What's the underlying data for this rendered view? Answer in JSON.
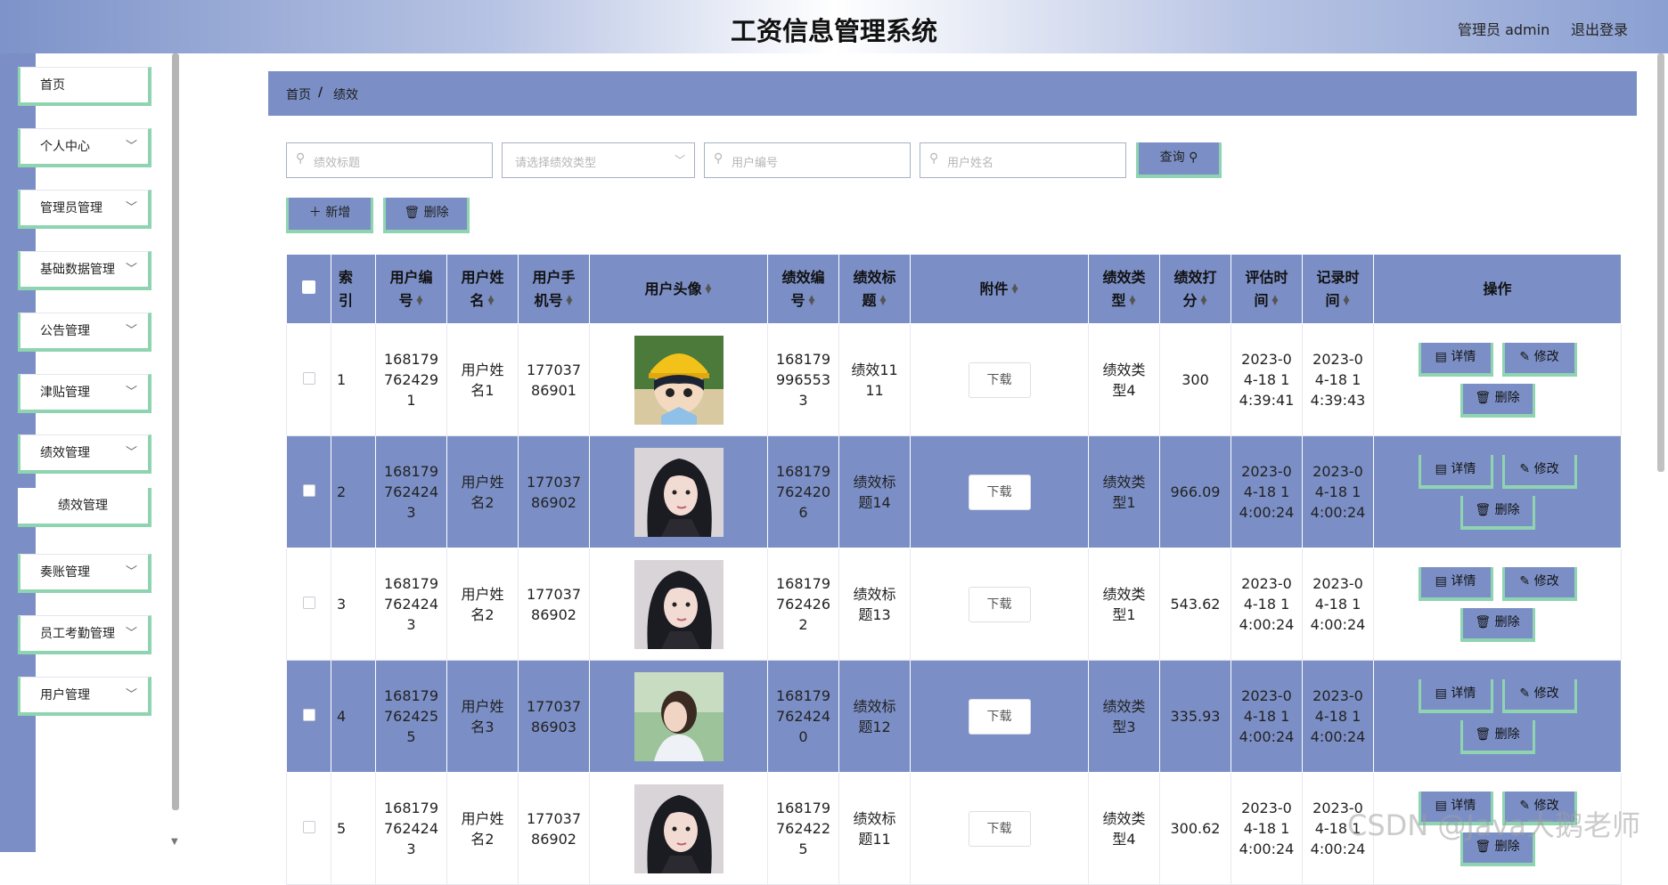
{
  "header": {
    "title": "工资信息管理系统",
    "admin": "管理员 admin",
    "logout": "退出登录"
  },
  "sidebar": {
    "items": [
      {
        "label": "首页",
        "chevron": false
      },
      {
        "label": "个人中心",
        "chevron": true
      },
      {
        "label": "管理员管理",
        "chevron": true
      },
      {
        "label": "基础数据管理",
        "chevron": true
      },
      {
        "label": "公告管理",
        "chevron": true
      },
      {
        "label": "津贴管理",
        "chevron": true
      },
      {
        "label": "绩效管理",
        "chevron": true
      },
      {
        "label": "绩效管理",
        "sub": true
      },
      {
        "label": "奏账管理",
        "chevron": true
      },
      {
        "label": "员工考勤管理",
        "chevron": true
      },
      {
        "label": "用户管理",
        "chevron": true
      }
    ]
  },
  "breadcrumb": {
    "home": "首页",
    "sep": "/",
    "current": "绩效"
  },
  "search": {
    "title_placeholder": "绩效标题",
    "type_placeholder": "请选择绩效类型",
    "user_no_placeholder": "用户编号",
    "user_name_placeholder": "用户姓名",
    "query_label": "查询"
  },
  "actions": {
    "add_label": "新增",
    "delete_label": "删除"
  },
  "table": {
    "headers": {
      "index": [
        "索",
        "引"
      ],
      "user_no": [
        "用户编",
        "号"
      ],
      "user_name": [
        "用户姓",
        "名"
      ],
      "user_phone": [
        "用户手",
        "机号"
      ],
      "avatar": "用户头像",
      "perf_no": [
        "绩效编",
        "号"
      ],
      "perf_title": [
        "绩效标",
        "题"
      ],
      "attachment": "附件",
      "perf_type": [
        "绩效类",
        "型"
      ],
      "perf_score": [
        "绩效打",
        "分"
      ],
      "eval_time": [
        "评估时",
        "间"
      ],
      "record_time": [
        "记录时",
        "间"
      ],
      "ops": "操作"
    },
    "rows": [
      {
        "index": "1",
        "user_no": [
          "168179",
          "762429",
          "1"
        ],
        "user_name": [
          "用户姓",
          "名1"
        ],
        "phone": [
          "177037",
          "86901"
        ],
        "avatar": "cartoon",
        "perf_no": [
          "168179",
          "996553",
          "3"
        ],
        "perf_title": [
          "绩效11",
          "11"
        ],
        "download": "下载",
        "type": [
          "绩效类",
          "型4"
        ],
        "score": "300",
        "eval": [
          "2023-0",
          "4-18 1",
          "4:39:41"
        ],
        "record": [
          "2023-0",
          "4-18 1",
          "4:39:43"
        ],
        "detail": "详情",
        "edit": "修改",
        "del": "删除"
      },
      {
        "index": "2",
        "user_no": [
          "168179",
          "762424",
          "3"
        ],
        "user_name": [
          "用户姓",
          "名2"
        ],
        "phone": [
          "177037",
          "86902"
        ],
        "avatar": "girl-dark",
        "perf_no": [
          "168179",
          "762420",
          "6"
        ],
        "perf_title": [
          "绩效标",
          "题14"
        ],
        "download": "下载",
        "type": [
          "绩效类",
          "型1"
        ],
        "score": "966.09",
        "eval": [
          "2023-0",
          "4-18 1",
          "4:00:24"
        ],
        "record": [
          "2023-0",
          "4-18 1",
          "4:00:24"
        ],
        "detail": "详情",
        "edit": "修改",
        "del": "删除"
      },
      {
        "index": "3",
        "user_no": [
          "168179",
          "762424",
          "3"
        ],
        "user_name": [
          "用户姓",
          "名2"
        ],
        "phone": [
          "177037",
          "86902"
        ],
        "avatar": "girl-dark",
        "perf_no": [
          "168179",
          "762426",
          "2"
        ],
        "perf_title": [
          "绩效标",
          "题13"
        ],
        "download": "下载",
        "type": [
          "绩效类",
          "型1"
        ],
        "score": "543.62",
        "eval": [
          "2023-0",
          "4-18 1",
          "4:00:24"
        ],
        "record": [
          "2023-0",
          "4-18 1",
          "4:00:24"
        ],
        "detail": "详情",
        "edit": "修改",
        "del": "删除"
      },
      {
        "index": "4",
        "user_no": [
          "168179",
          "762425",
          "5"
        ],
        "user_name": [
          "用户姓",
          "名3"
        ],
        "phone": [
          "177037",
          "86903"
        ],
        "avatar": "girl-outdoor",
        "perf_no": [
          "168179",
          "762424",
          "0"
        ],
        "perf_title": [
          "绩效标",
          "题12"
        ],
        "download": "下载",
        "type": [
          "绩效类",
          "型3"
        ],
        "score": "335.93",
        "eval": [
          "2023-0",
          "4-18 1",
          "4:00:24"
        ],
        "record": [
          "2023-0",
          "4-18 1",
          "4:00:24"
        ],
        "detail": "详情",
        "edit": "修改",
        "del": "删除"
      },
      {
        "index": "5",
        "user_no": [
          "168179",
          "762424",
          "3"
        ],
        "user_name": [
          "用户姓",
          "名2"
        ],
        "phone": [
          "177037",
          "86902"
        ],
        "avatar": "girl-dark",
        "perf_no": [
          "168179",
          "762422",
          "5"
        ],
        "perf_title": [
          "绩效标",
          "题11"
        ],
        "download": "下载",
        "type": [
          "绩效类",
          "型4"
        ],
        "score": "300.62",
        "eval": [
          "2023-0",
          "4-18 1",
          "4:00:24"
        ],
        "record": [
          "2023-0",
          "4-18 1",
          "4:00:24"
        ],
        "detail": "详情",
        "edit": "修改",
        "del": "删除"
      }
    ]
  },
  "watermark": "CSDN @Java大鹅老师",
  "colors": {
    "accent": "#7b8fc6",
    "accent_border": "#8fd4b0"
  }
}
